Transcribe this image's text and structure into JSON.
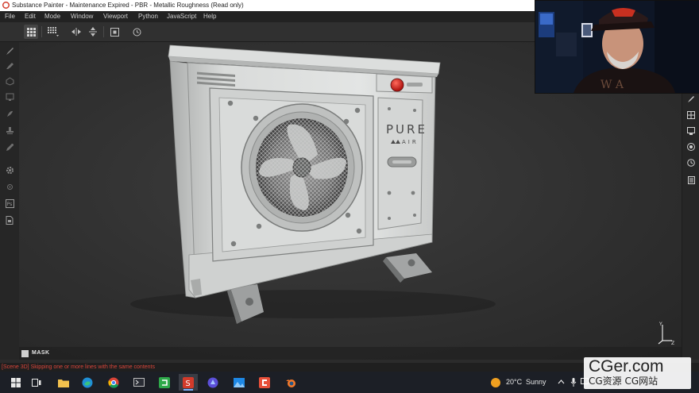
{
  "window": {
    "title": "Substance Painter - Maintenance Expired - PBR - Metallic Roughness (Read only)"
  },
  "menu": {
    "items": [
      "File",
      "Edit",
      "Mode",
      "Window",
      "Viewport",
      "Python",
      "JavaScript",
      "Help"
    ]
  },
  "toolbar": {
    "buttons": [
      "grid-2x2-icon",
      "grid-3x3-icon",
      "flip-horizontal-icon",
      "flip-vertical-icon",
      "frame-icon",
      "history-icon"
    ]
  },
  "left_tools": [
    "paint-brush-icon",
    "eraser-icon",
    "projection-icon",
    "polygon-fill-icon",
    "smudge-icon",
    "clone-stamp-icon",
    "color-picker-icon",
    "settings-icon",
    "bake-icon",
    "photoshop-export-icon",
    "document-icon"
  ],
  "right_tools": [
    "brush-settings-icon",
    "texture-set-icon",
    "display-settings-icon",
    "viewer-settings-icon",
    "history-icon",
    "shelf-icon"
  ],
  "viewport": {
    "model_label_brand": "PURE",
    "model_label_sub": "AIR",
    "mask_label": "MASK"
  },
  "status": {
    "message": "[Scene 3D] Skipping one or more lines with the same contents"
  },
  "taskbar": {
    "apps": [
      "start-icon",
      "task-view-icon",
      "file-explorer-icon",
      "edge-icon",
      "chrome-icon",
      "terminal-icon",
      "camtasia-icon",
      "substance-painter-icon",
      "edge-dev-icon",
      "photos-icon",
      "recorder-icon",
      "blender-icon"
    ],
    "weather_temp": "20°C",
    "weather_condition": "Sunny"
  },
  "watermark": {
    "line1": "CGer.com",
    "line2": "CG资源 CG网站"
  },
  "colors": {
    "accent": "#7fb2ff",
    "status_error": "#d8453a",
    "button_red": "#c8201c"
  }
}
